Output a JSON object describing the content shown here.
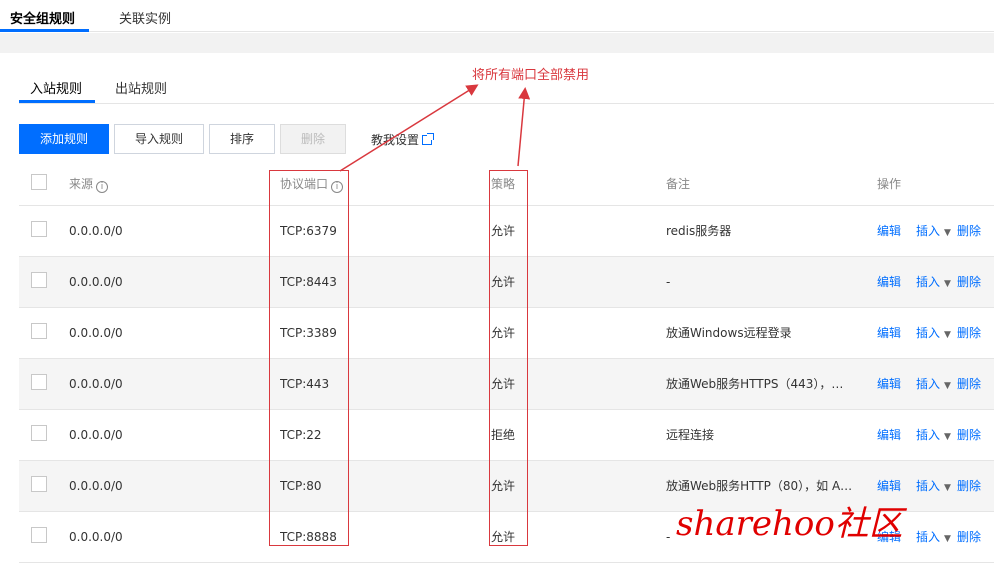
{
  "top_tabs": {
    "security_group_rules": "安全组规则",
    "linked_instances": "关联实例"
  },
  "sub_tabs": {
    "inbound": "入站规则",
    "outbound": "出站规则"
  },
  "toolbar": {
    "add_rule": "添加规则",
    "import_rule": "导入规则",
    "sort": "排序",
    "delete": "删除",
    "tutorial": "教我设置"
  },
  "table": {
    "headers": {
      "source": "来源",
      "protocol_port": "协议端口",
      "policy": "策略",
      "remark": "备注",
      "operation": "操作"
    },
    "rows": [
      {
        "source": "0.0.0.0/0",
        "protocol_port": "TCP:6379",
        "policy": "允许",
        "remark": "redis服务器",
        "edit": "编辑",
        "insert": "插入",
        "delete": "删除"
      },
      {
        "source": "0.0.0.0/0",
        "protocol_port": "TCP:8443",
        "policy": "允许",
        "remark": "-",
        "edit": "编辑",
        "insert": "插入",
        "delete": "删除"
      },
      {
        "source": "0.0.0.0/0",
        "protocol_port": "TCP:3389",
        "policy": "允许",
        "remark": "放通Windows远程登录",
        "edit": "编辑",
        "insert": "插入",
        "delete": "删除"
      },
      {
        "source": "0.0.0.0/0",
        "protocol_port": "TCP:443",
        "policy": "允许",
        "remark": "放通Web服务HTTPS（443），…",
        "edit": "编辑",
        "insert": "插入",
        "delete": "删除"
      },
      {
        "source": "0.0.0.0/0",
        "protocol_port": "TCP:22",
        "policy": "拒绝",
        "remark": "远程连接",
        "edit": "编辑",
        "insert": "插入",
        "delete": "删除"
      },
      {
        "source": "0.0.0.0/0",
        "protocol_port": "TCP:80",
        "policy": "允许",
        "remark": "放通Web服务HTTP（80），如 A…",
        "edit": "编辑",
        "insert": "插入",
        "delete": "删除"
      },
      {
        "source": "0.0.0.0/0",
        "protocol_port": "TCP:8888",
        "policy": "允许",
        "remark": "-",
        "edit": "编辑",
        "insert": "插入",
        "delete": "删除"
      }
    ]
  },
  "annotation": {
    "text": "将所有端口全部禁用",
    "color": "#d9383e"
  },
  "watermark": "sharehoo社区",
  "colors": {
    "accent": "#006eff",
    "annotation_red": "#d9383e"
  }
}
